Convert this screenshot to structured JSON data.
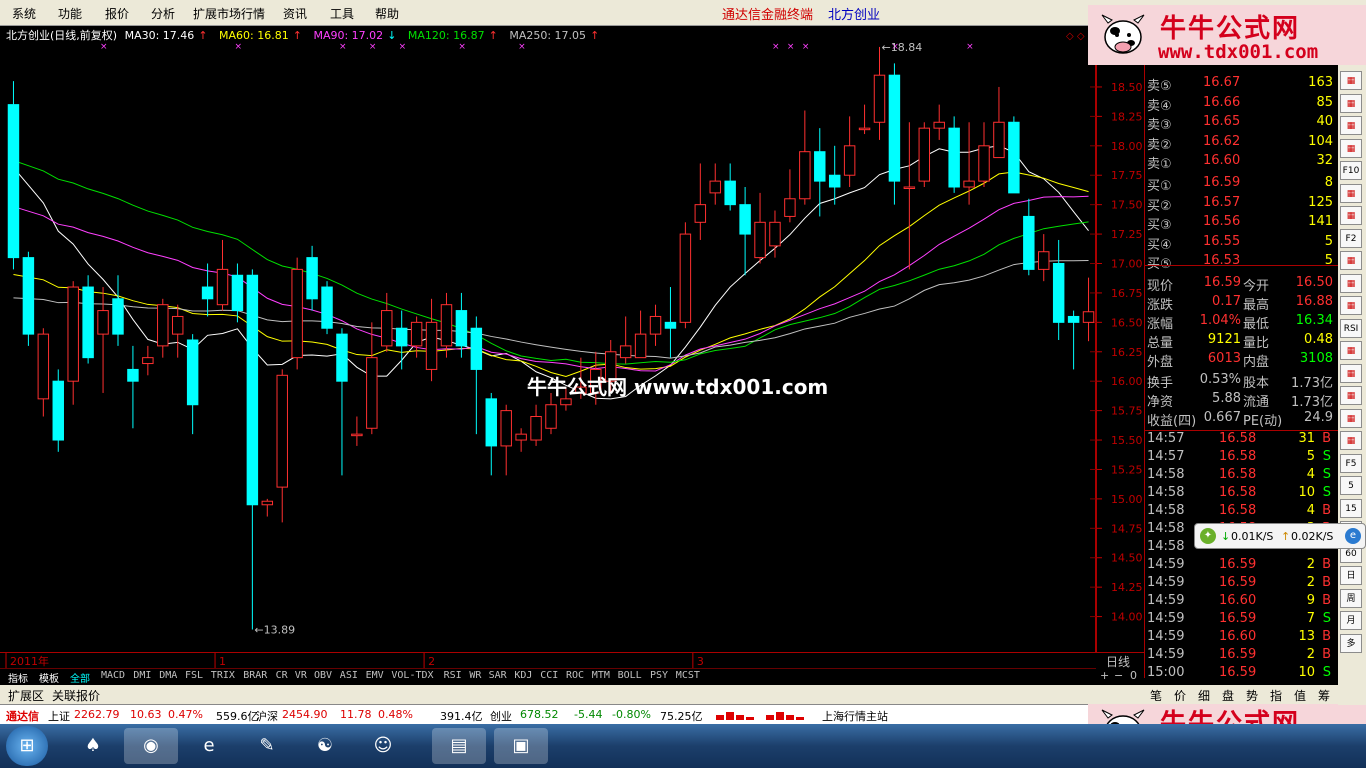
{
  "menu": [
    "系统",
    "功能",
    "报价",
    "分析",
    "扩展市场行情",
    "资讯",
    "工具",
    "帮助"
  ],
  "app_title": "通达信金融终端",
  "stock_name": "北方创业",
  "logo": {
    "cn": "牛牛公式网",
    "url": "www.tdx001.com"
  },
  "chart_header": {
    "title": "北方创业(日线,前复权)",
    "ma": [
      {
        "label": "MA30: 17.46",
        "arrow": "↑",
        "color": "#ffffff"
      },
      {
        "label": "MA60: 16.81",
        "arrow": "↑",
        "color": "#ffff00"
      },
      {
        "label": "MA90: 17.02",
        "arrow": "↓",
        "color": "#ff40ff"
      },
      {
        "label": "MA120: 16.87",
        "arrow": "↑",
        "color": "#00e000"
      },
      {
        "label": "MA250: 17.05",
        "arrow": "↑",
        "color": "#c0c0c0"
      }
    ]
  },
  "chart_data": {
    "type": "candlestick",
    "y_ticks": [
      "18.50",
      "18.25",
      "18.00",
      "17.75",
      "17.50",
      "17.25",
      "17.00",
      "16.75",
      "16.50",
      "16.25",
      "16.00",
      "15.75",
      "15.50",
      "15.25",
      "15.00",
      "14.75",
      "14.50",
      "14.25",
      "14.00"
    ],
    "ylim": [
      13.75,
      18.95
    ],
    "x_labels": [
      {
        "text": "2011年",
        "i": 0
      },
      {
        "text": "1",
        "i": 14
      },
      {
        "text": "2",
        "i": 28
      },
      {
        "text": "3",
        "i": 46
      }
    ],
    "high_label": "18.84",
    "low_label": "13.89",
    "candles": [
      [
        18.35,
        17.05,
        18.55,
        16.95
      ],
      [
        17.05,
        16.4,
        17.1,
        16.3
      ],
      [
        15.85,
        16.4,
        16.45,
        15.7
      ],
      [
        16.0,
        15.5,
        16.1,
        15.4
      ],
      [
        16.0,
        16.8,
        16.85,
        15.8
      ],
      [
        16.8,
        16.2,
        16.9,
        16.15
      ],
      [
        16.4,
        16.6,
        16.8,
        15.9
      ],
      [
        16.7,
        16.4,
        16.9,
        16.3
      ],
      [
        16.1,
        16.0,
        16.3,
        15.6
      ],
      [
        16.15,
        16.2,
        16.3,
        16.05
      ],
      [
        16.3,
        16.65,
        16.7,
        16.2
      ],
      [
        16.4,
        16.55,
        16.65,
        16.2
      ],
      [
        16.35,
        15.8,
        16.4,
        15.55
      ],
      [
        16.8,
        16.7,
        17.0,
        16.55
      ],
      [
        16.65,
        16.95,
        17.2,
        16.6
      ],
      [
        16.9,
        16.6,
        17.0,
        16.5
      ],
      [
        16.9,
        14.95,
        16.95,
        13.89
      ],
      [
        14.95,
        14.98,
        15.0,
        14.85
      ],
      [
        15.1,
        16.05,
        16.1,
        14.8
      ],
      [
        16.2,
        16.95,
        17.05,
        16.1
      ],
      [
        17.05,
        16.7,
        17.15,
        16.6
      ],
      [
        16.8,
        16.45,
        16.85,
        16.4
      ],
      [
        16.4,
        16.0,
        16.45,
        15.2
      ],
      [
        15.55,
        15.55,
        15.7,
        15.45
      ],
      [
        15.6,
        16.2,
        16.5,
        15.55
      ],
      [
        16.3,
        16.6,
        16.75,
        16.25
      ],
      [
        16.45,
        16.3,
        16.6,
        16.1
      ],
      [
        16.3,
        16.5,
        16.55,
        16.2
      ],
      [
        16.1,
        16.5,
        16.7,
        16.0
      ],
      [
        16.3,
        16.65,
        16.75,
        16.2
      ],
      [
        16.6,
        16.3,
        16.75,
        16.2
      ],
      [
        16.45,
        16.1,
        16.55,
        15.55
      ],
      [
        15.85,
        15.45,
        15.9,
        15.2
      ],
      [
        15.45,
        15.75,
        15.8,
        15.2
      ],
      [
        15.5,
        15.55,
        15.6,
        15.4
      ],
      [
        15.5,
        15.7,
        15.8,
        15.45
      ],
      [
        15.6,
        15.8,
        15.9,
        15.55
      ],
      [
        15.8,
        15.85,
        15.95,
        15.75
      ],
      [
        15.9,
        15.95,
        16.2,
        15.85
      ],
      [
        15.9,
        16.1,
        16.25,
        15.8
      ],
      [
        16.0,
        16.25,
        16.35,
        15.9
      ],
      [
        16.2,
        16.3,
        16.55,
        16.15
      ],
      [
        16.2,
        16.4,
        16.6,
        16.2
      ],
      [
        16.4,
        16.55,
        16.65,
        16.3
      ],
      [
        16.5,
        16.45,
        16.8,
        16.2
      ],
      [
        16.5,
        17.25,
        17.35,
        16.45
      ],
      [
        17.35,
        17.5,
        17.85,
        17.2
      ],
      [
        17.6,
        17.7,
        17.85,
        17.5
      ],
      [
        17.7,
        17.5,
        17.85,
        17.45
      ],
      [
        17.5,
        17.25,
        17.65,
        16.9
      ],
      [
        17.05,
        17.35,
        17.6,
        17.0
      ],
      [
        17.15,
        17.35,
        17.45,
        17.05
      ],
      [
        17.4,
        17.55,
        17.8,
        17.35
      ],
      [
        17.55,
        17.95,
        18.3,
        17.5
      ],
      [
        17.95,
        17.7,
        18.15,
        17.4
      ],
      [
        17.75,
        17.65,
        18.0,
        17.5
      ],
      [
        17.75,
        18.0,
        18.25,
        17.65
      ],
      [
        18.15,
        18.15,
        18.35,
        18.1
      ],
      [
        18.2,
        18.6,
        18.84,
        18.05
      ],
      [
        18.6,
        17.7,
        18.7,
        17.5
      ],
      [
        17.65,
        17.65,
        18.2,
        16.95
      ],
      [
        17.7,
        18.15,
        18.2,
        17.65
      ],
      [
        18.15,
        18.2,
        18.35,
        18.05
      ],
      [
        18.15,
        17.65,
        18.25,
        17.6
      ],
      [
        17.65,
        17.7,
        18.2,
        17.5
      ],
      [
        17.7,
        18.0,
        18.2,
        17.65
      ],
      [
        17.9,
        18.2,
        18.5,
        17.9
      ],
      [
        18.2,
        17.6,
        18.25,
        17.6
      ],
      [
        17.4,
        16.95,
        17.55,
        16.9
      ],
      [
        16.95,
        17.1,
        17.25,
        16.85
      ],
      [
        17.0,
        16.5,
        17.2,
        16.35
      ],
      [
        16.55,
        16.5,
        16.6,
        16.1
      ],
      [
        16.5,
        16.59,
        16.88,
        16.34
      ]
    ]
  },
  "quotes": {
    "sell": [
      {
        "label": "卖⑤",
        "price": "16.67",
        "vol": "163"
      },
      {
        "label": "卖④",
        "price": "16.66",
        "vol": "85"
      },
      {
        "label": "卖③",
        "price": "16.65",
        "vol": "40"
      },
      {
        "label": "卖②",
        "price": "16.62",
        "vol": "104"
      },
      {
        "label": "卖①",
        "price": "16.60",
        "vol": "32"
      }
    ],
    "buy": [
      {
        "label": "买①",
        "price": "16.59",
        "vol": "8"
      },
      {
        "label": "买②",
        "price": "16.57",
        "vol": "125"
      },
      {
        "label": "买③",
        "price": "16.56",
        "vol": "141"
      },
      {
        "label": "买④",
        "price": "16.55",
        "vol": "5"
      },
      {
        "label": "买⑤",
        "price": "16.53",
        "vol": "5"
      }
    ],
    "stats": [
      {
        "l1": "现价",
        "v1": "16.59",
        "c1": "#ff3030",
        "l2": "今开",
        "v2": "16.50",
        "c2": "#ff3030"
      },
      {
        "l1": "涨跌",
        "v1": "0.17",
        "c1": "#ff3030",
        "l2": "最高",
        "v2": "16.88",
        "c2": "#ff3030"
      },
      {
        "l1": "涨幅",
        "v1": "1.04%",
        "c1": "#ff3030",
        "l2": "最低",
        "v2": "16.34",
        "c2": "#00ff00"
      },
      {
        "l1": "总量",
        "v1": "9121",
        "c1": "#ffff00",
        "l2": "量比",
        "v2": "0.48",
        "c2": "#ffff00"
      },
      {
        "l1": "外盘",
        "v1": "6013",
        "c1": "#ff3030",
        "l2": "内盘",
        "v2": "3108",
        "c2": "#00ff00"
      }
    ],
    "fund": [
      {
        "l1": "换手",
        "v1": "0.53%",
        "l2": "股本",
        "v2": "1.73亿"
      },
      {
        "l1": "净资",
        "v1": "5.88",
        "l2": "流通",
        "v2": "1.73亿"
      },
      {
        "l1": "收益(四)",
        "v1": "0.667",
        "l2": "PE(动)",
        "v2": "24.9"
      }
    ],
    "ticks": [
      {
        "t": "14:57",
        "p": "16.58",
        "v": "31",
        "s": "B"
      },
      {
        "t": "14:57",
        "p": "16.58",
        "v": "5",
        "s": "S"
      },
      {
        "t": "14:58",
        "p": "16.58",
        "v": "4",
        "s": "S"
      },
      {
        "t": "14:58",
        "p": "16.58",
        "v": "10",
        "s": "S"
      },
      {
        "t": "14:58",
        "p": "16.58",
        "v": "4",
        "s": "B"
      },
      {
        "t": "14:58",
        "p": "16.58",
        "v": "3",
        "s": "B"
      },
      {
        "t": "14:58",
        "p": "",
        "v": "",
        "s": ""
      },
      {
        "t": "14:59",
        "p": "16.59",
        "v": "2",
        "s": "B"
      },
      {
        "t": "14:59",
        "p": "16.59",
        "v": "2",
        "s": "B"
      },
      {
        "t": "14:59",
        "p": "16.60",
        "v": "9",
        "s": "B"
      },
      {
        "t": "14:59",
        "p": "16.59",
        "v": "7",
        "s": "S"
      },
      {
        "t": "14:59",
        "p": "16.60",
        "v": "13",
        "s": "B"
      },
      {
        "t": "14:59",
        "p": "16.59",
        "v": "2",
        "s": "B"
      },
      {
        "t": "15:00",
        "p": "16.59",
        "v": "10",
        "s": "S"
      }
    ]
  },
  "right_toolbar": [
    "",
    "",
    "",
    "",
    "F10",
    "",
    "",
    "F2",
    "",
    "",
    "",
    "RSI",
    "",
    "",
    "",
    "",
    "",
    "F5",
    "5",
    "15",
    "30",
    "60",
    "日",
    "周",
    "月",
    "多"
  ],
  "axis_label_right": "日线",
  "indicator_tabs": [
    "指标",
    "模板",
    "全部",
    "MACD",
    "DMI",
    "DMA",
    "FSL",
    "TRIX",
    "BRAR",
    "CR",
    "VR",
    "OBV",
    "ASI",
    "EMV",
    "VOL-TDX",
    "RSI",
    "WR",
    "SAR",
    "KDJ",
    "CCI",
    "ROC",
    "MTM",
    "BOLL",
    "PSY",
    "MCST"
  ],
  "section_tabs": [
    "扩展区",
    "关联报价"
  ],
  "bottom_tabs": [
    "笔",
    "价",
    "细",
    "盘",
    "势",
    "指",
    "值",
    "筹"
  ],
  "status": {
    "brand": "通达信",
    "sh": {
      "name": "上证",
      "val": "2262.79",
      "chg": "10.63",
      "pct": "0.47%",
      "amt": "559.6亿"
    },
    "sz": {
      "name": "沪深",
      "val": "2454.90",
      "chg": "11.78",
      "pct": "0.48%",
      "amt": "391.4亿"
    },
    "cy": {
      "name": "创业",
      "val": "678.52",
      "chg": "-5.44",
      "pct": "-0.80%",
      "amt": "75.25亿"
    },
    "server": "上海行情主站"
  },
  "speed": {
    "down": "0.01K/S",
    "up": "0.02K/S"
  },
  "watermark": "牛牛公式网 www.tdx001.com",
  "colors": {
    "up": "#ff3030",
    "down": "#00ffff",
    "grid": "#800000"
  }
}
